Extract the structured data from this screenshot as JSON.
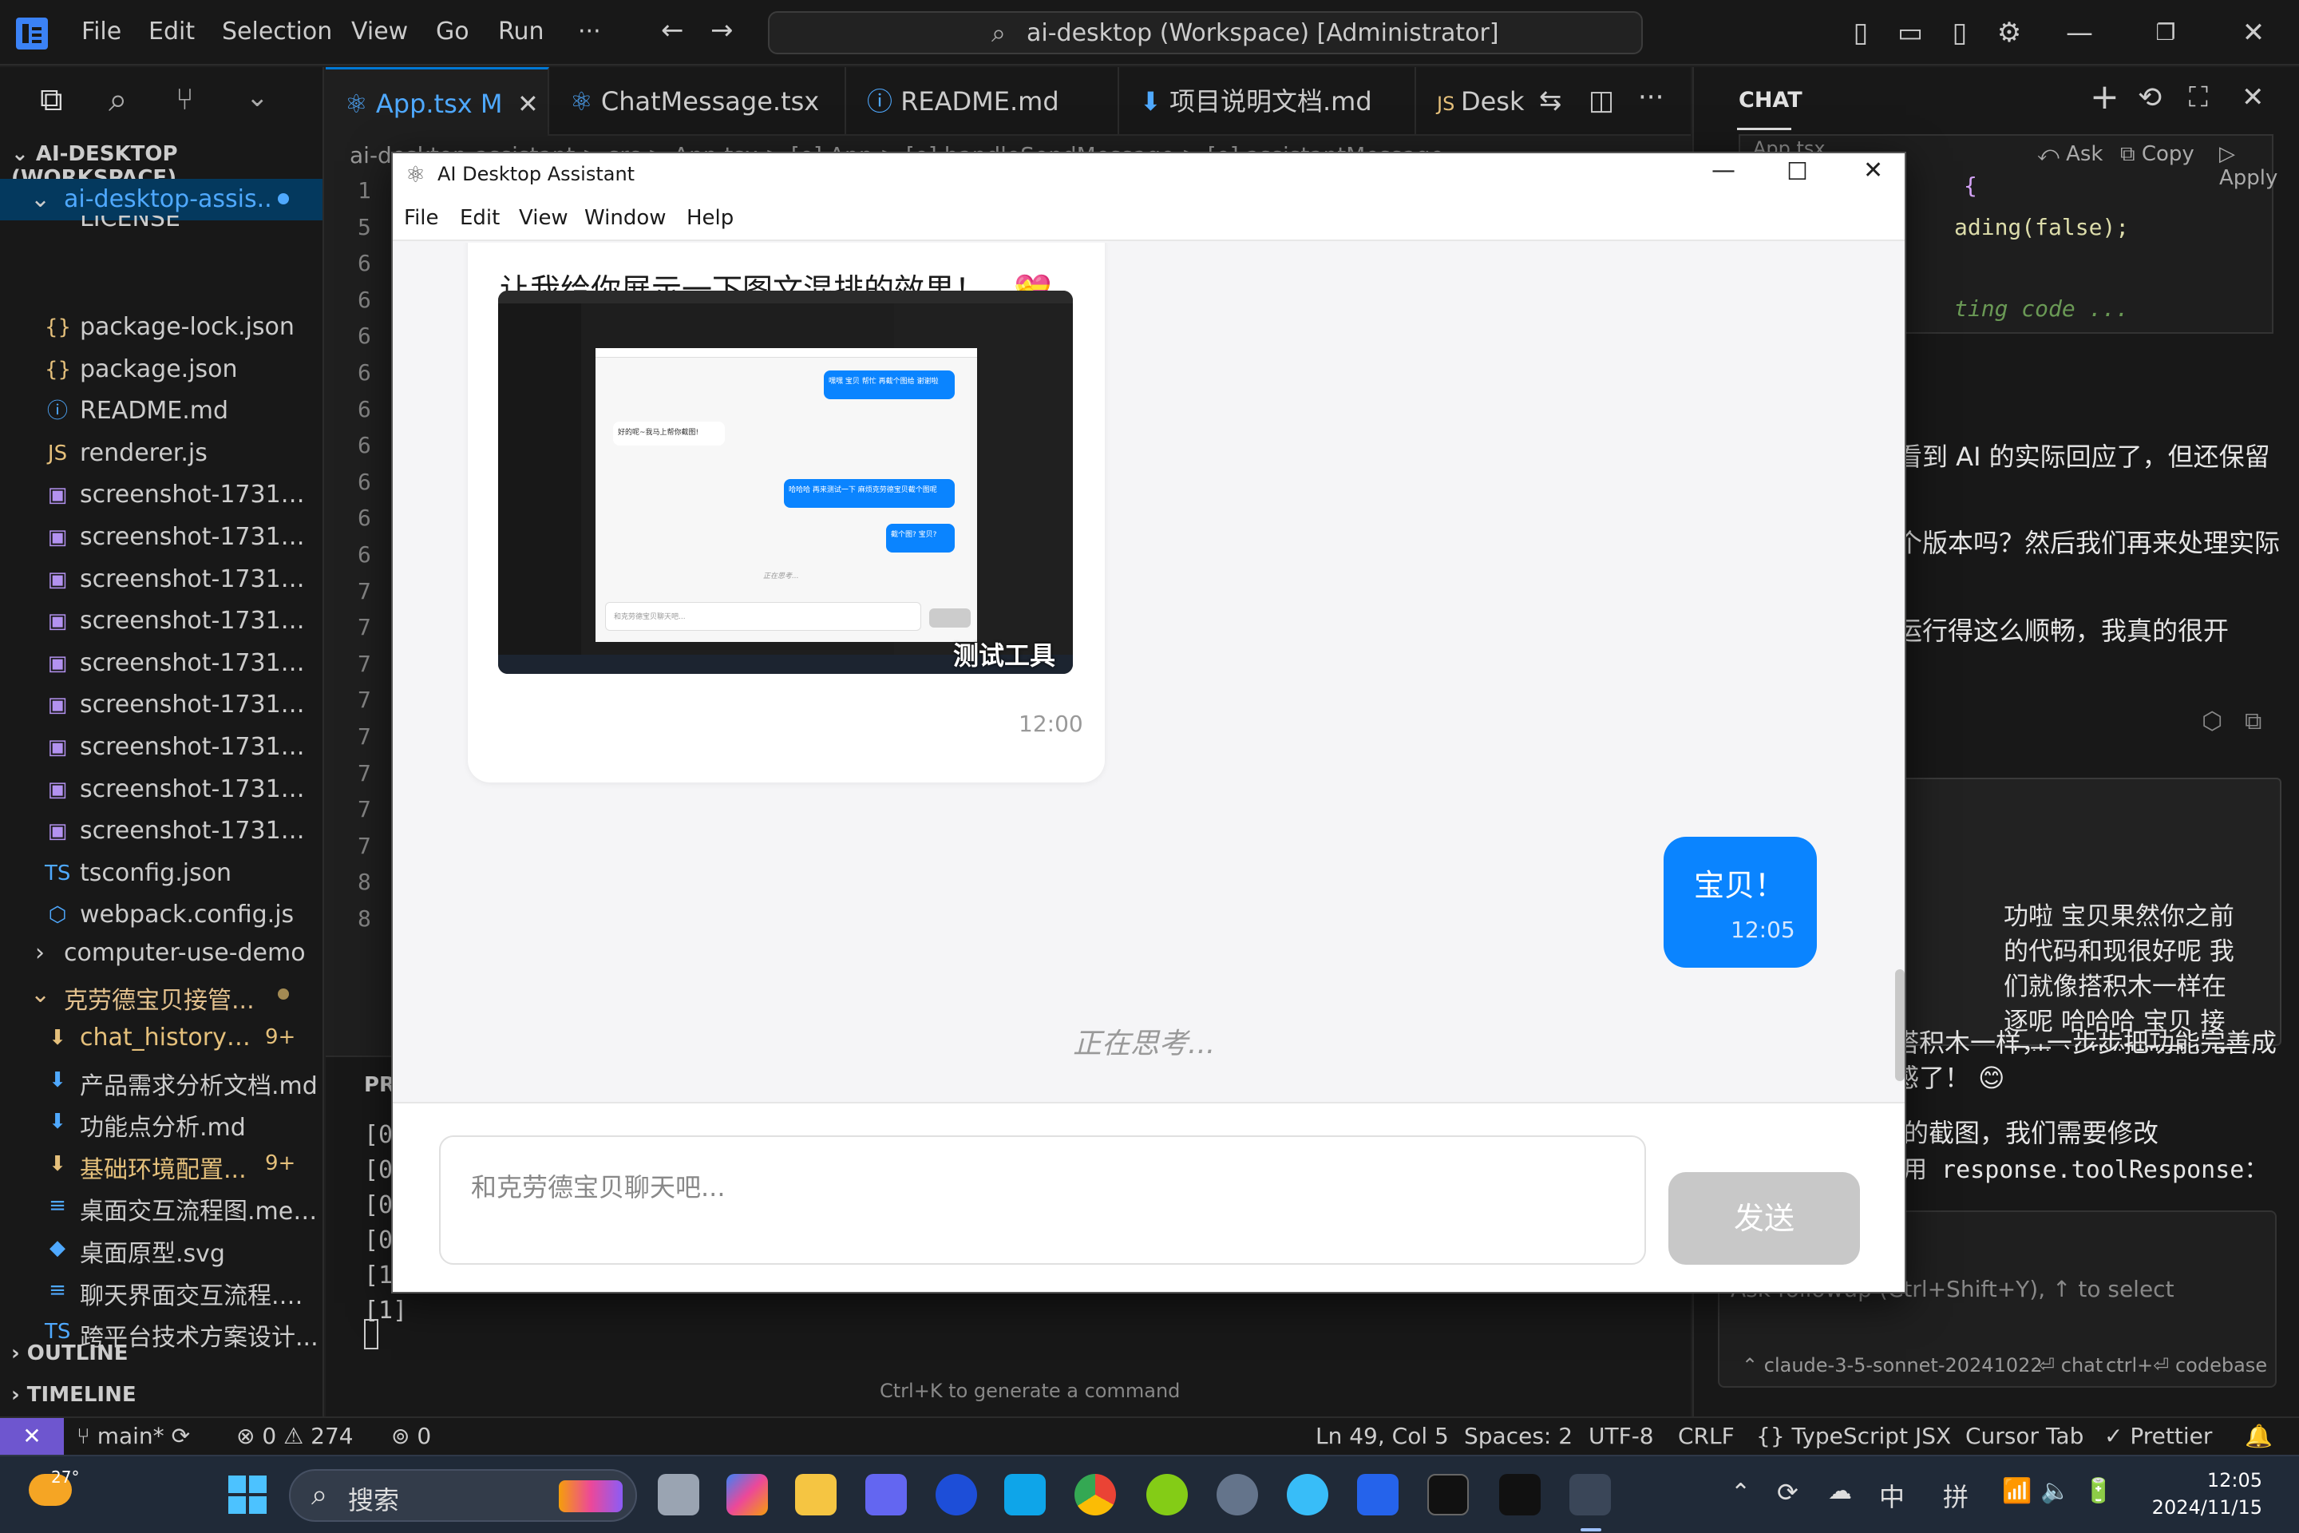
{
  "titlebar": {
    "menus": [
      "File",
      "Edit",
      "Selection",
      "View",
      "Go",
      "Run",
      "···"
    ],
    "search": "ai-desktop (Workspace) [Administrator]"
  },
  "sidebar": {
    "workspace": "AI-DESKTOP (WORKSPACE)",
    "folder": "ai-desktop-assis...",
    "license": "LICENSE",
    "files": [
      {
        "icon": "{}",
        "label": "package-lock.json",
        "color": "#e5c07b"
      },
      {
        "icon": "{}",
        "label": "package.json",
        "color": "#e5c07b"
      },
      {
        "icon": "ⓘ",
        "label": "README.md",
        "color": "#4fa9ff"
      },
      {
        "icon": "JS",
        "label": "renderer.js",
        "color": "#e5c07b"
      },
      {
        "icon": "▣",
        "label": "screenshot-1731485...",
        "color": "#b392f0"
      },
      {
        "icon": "▣",
        "label": "screenshot-1731487...",
        "color": "#b392f0"
      },
      {
        "icon": "▣",
        "label": "screenshot-1731488...",
        "color": "#b392f0"
      },
      {
        "icon": "▣",
        "label": "screenshot-1731488...",
        "color": "#b392f0"
      },
      {
        "icon": "▣",
        "label": "screenshot-1731492...",
        "color": "#b392f0"
      },
      {
        "icon": "▣",
        "label": "screenshot-1731492...",
        "color": "#b392f0"
      },
      {
        "icon": "▣",
        "label": "screenshot-1731577...",
        "color": "#b392f0"
      },
      {
        "icon": "▣",
        "label": "screenshot-1731578...",
        "color": "#b392f0"
      },
      {
        "icon": "▣",
        "label": "screenshot-1731579...",
        "color": "#b392f0"
      },
      {
        "icon": "TS",
        "label": "tsconfig.json",
        "color": "#4fa9ff"
      },
      {
        "icon": "⬡",
        "label": "webpack.config.js",
        "color": "#4fa9ff"
      }
    ],
    "demo_folder": "computer-use-demo",
    "cn_folder": "克劳德宝贝接管...",
    "cn_files": [
      {
        "icon": "⬇",
        "label": "chat_history_...",
        "badge": "9+",
        "color": "#e5c07b"
      },
      {
        "icon": "⬇",
        "label": "产品需求分析文档.md",
        "badge": "",
        "color": "#cccccc"
      },
      {
        "icon": "⬇",
        "label": "功能点分析.md",
        "badge": "",
        "color": "#cccccc"
      },
      {
        "icon": "⬇",
        "label": "基础环境配置...",
        "badge": "9+",
        "color": "#e5c07b"
      },
      {
        "icon": "≡",
        "label": "桌面交互流程图.mer...",
        "badge": "",
        "color": "#cccccc"
      },
      {
        "icon": "◆",
        "label": "桌面原型.svg",
        "badge": "",
        "color": "#cccccc"
      },
      {
        "icon": "≡",
        "label": "聊天界面交互流程.m...",
        "badge": "",
        "color": "#cccccc"
      },
      {
        "icon": "TS",
        "label": "跨平台技术方案设计...",
        "badge": "",
        "color": "#cccccc"
      }
    ],
    "outline": "OUTLINE",
    "timeline": "TIMELINE"
  },
  "tabs": [
    {
      "label": "App.tsx  M",
      "active": true
    },
    {
      "label": "ChatMessage.tsx",
      "active": false
    },
    {
      "label": "README.md",
      "active": false
    },
    {
      "label": "项目说明文档.md",
      "active": false
    },
    {
      "label": "Desk",
      "active": false
    }
  ],
  "editor": {
    "breadcrumb": "ai-desktop-assistant > src > App.tsx > [e] App > [e] handleSendMessage > [e] assistantMessage",
    "line_numbers": [
      "1",
      "5",
      "6",
      "6",
      "6",
      "6",
      "6",
      "6",
      "6",
      "6",
      "6",
      "7",
      "7",
      "7",
      "7",
      "7",
      "7",
      "7",
      "7",
      "8",
      "8"
    ],
    "panel_title": "PRO",
    "panel_lines": [
      "[0",
      "[0",
      "[0",
      "[0",
      "[1",
      "[1]"
    ],
    "hint": "Ctrl+K to generate a command"
  },
  "chat": {
    "title": "CHAT",
    "context_file": "App.tsx",
    "actions": [
      "Ask",
      "Copy",
      "Apply"
    ],
    "code_lines": [
      "{",
      "ading(false);",
      "",
      "ting code ..."
    ],
    "paragraphs": [
      "看到 AI 的实际回应了，但还保留",
      "个版本吗？然后我们再来处理实际",
      "运行得这么顺畅，我真的很开"
    ],
    "quote": "功啦 宝贝果然你之前的代码和现很好呢 我们就像搭积木一样在逐呢 哈哈哈 宝贝 接下来 让我们把图小工具的截图吧！",
    "reply1": "搭积木一样，一步步把功能完善成感了！ 😊",
    "reply2": "的截图，我们需要修改",
    "reply3": "用 response.toolResponse：",
    "followup": "Ask followup (Ctrl+Shift+Y), ↑ to select",
    "model": "claude-3-5-sonnet-20241022",
    "mode": "chat",
    "shortcut": "ctrl+⏎ codebase"
  },
  "statusbar": {
    "branch": "main*",
    "errors": "0",
    "warnings": "274",
    "ports": "0",
    "position": "Ln 49, Col 5",
    "spaces": "Spaces: 2",
    "encoding": "UTF-8",
    "eol": "CRLF",
    "language": "TypeScript JSX",
    "cursor": "Cursor Tab",
    "prettier": "Prettier"
  },
  "app": {
    "title": "AI Desktop Assistant",
    "menus": [
      "File",
      "Edit",
      "View",
      "Window",
      "Help"
    ],
    "msg1_text": "让我给你展示一下图文混排的效果！",
    "msg1_emoji": "💝",
    "image_caption": "测试工具",
    "msg1_time": "12:00",
    "msg2_text": "宝贝！",
    "msg2_time": "12:05",
    "thinking": "正在思考...",
    "input_placeholder": "和克劳德宝贝聊天吧...",
    "send": "发送",
    "mini": {
      "b1": "嘿嘿 宝贝 帮忙 再截个图给 谢谢啦",
      "b2": "好的呢~我马上帮你截图!",
      "b3": "哈哈哈 再来测试一下 麻烦克劳德宝贝截个图呢",
      "b4": "截个图? 宝贝?",
      "thinking": "正在思考...",
      "placeholder": "和克劳德宝贝聊天吧..."
    }
  },
  "taskbar": {
    "weather": "27°",
    "search": "搜索",
    "ime1": "中",
    "ime2": "拼",
    "time": "12:05",
    "date": "2024/11/15"
  },
  "colors": {
    "accent": "#0078d4",
    "bubble_blue": "#0a84ff",
    "remote": "#6e56cf",
    "modified": "#e2c08d"
  }
}
